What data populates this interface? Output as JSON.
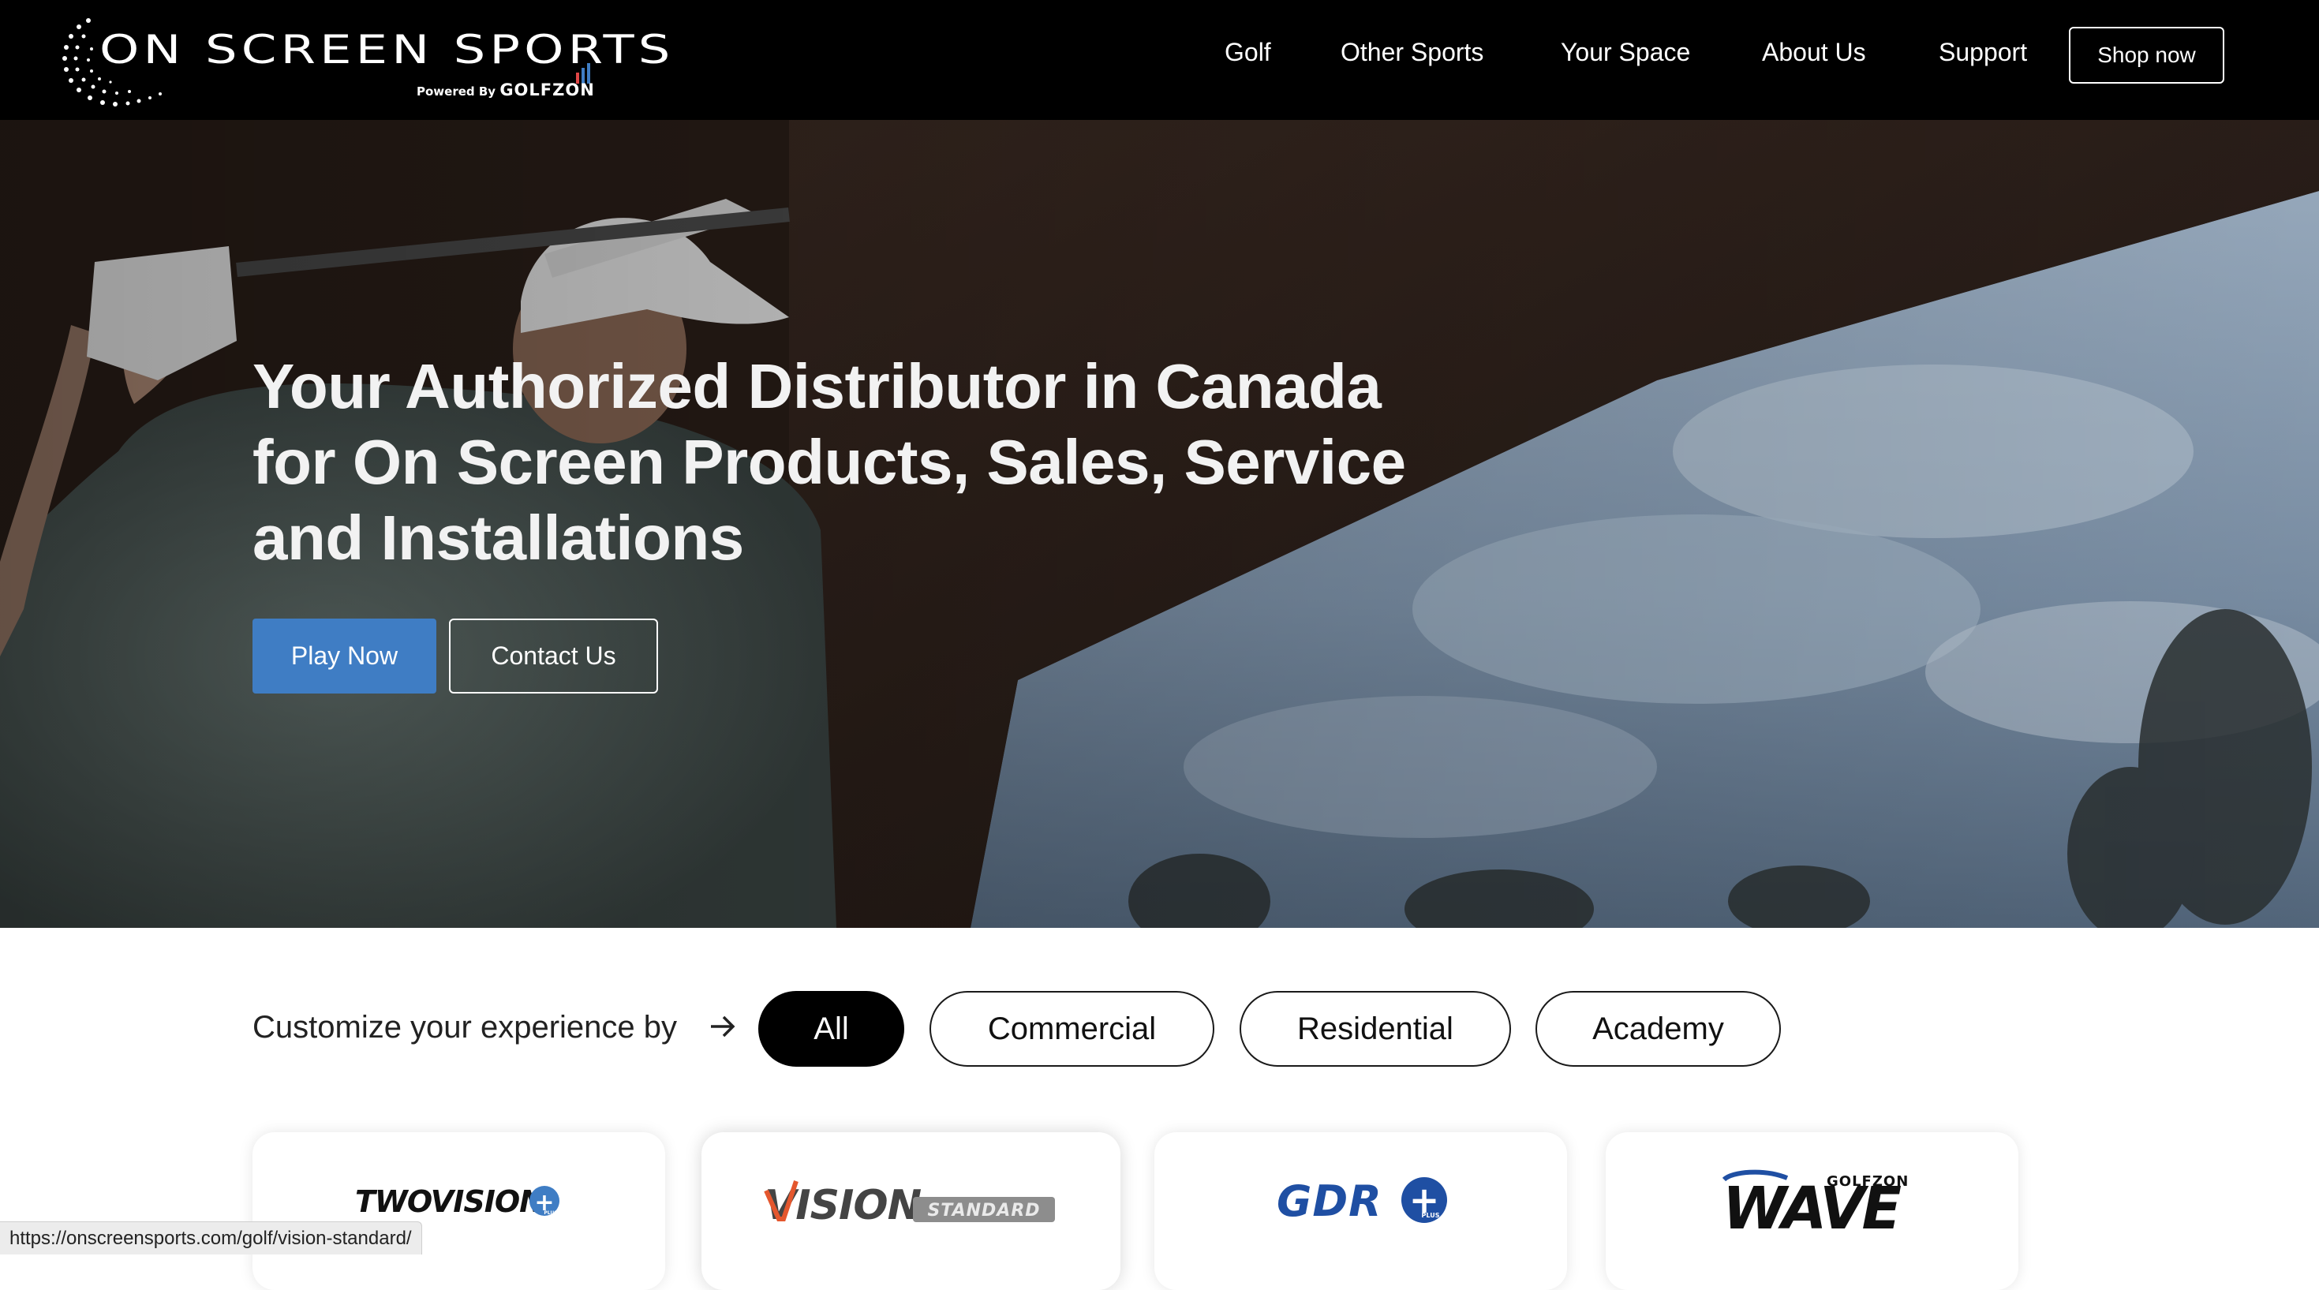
{
  "brand": {
    "title": "ON SCREEN SPORTS",
    "powered_by": "Powered By",
    "partner": "GOLFZON"
  },
  "nav": {
    "links": [
      "Golf",
      "Other Sports",
      "Your Space",
      "About Us",
      "Support"
    ],
    "cta": "Shop now"
  },
  "hero": {
    "title": "Your Authorized Distributor in Canada for On Screen Products, Sales, Service and Installations",
    "primary_button": "Play Now",
    "secondary_button": "Contact Us"
  },
  "filter": {
    "label": "Customize your experience by",
    "arrow_icon": "arrow-right-icon",
    "options": [
      "All",
      "Commercial",
      "Residential",
      "Academy"
    ],
    "selected": "All"
  },
  "products": [
    {
      "name": "TWOVISION",
      "badge": "+",
      "badge_sub": "PLUS"
    },
    {
      "name": "VISION",
      "badge": "STANDARD"
    },
    {
      "name": "GDR",
      "badge": "+",
      "badge_sub": "PLUS"
    },
    {
      "name": "WAVE",
      "brand": "GOLFZON"
    }
  ],
  "colors": {
    "nav_bg": "#000000",
    "primary": "#3f7dc4",
    "gdr_blue": "#1f4fa3",
    "vision_orange": "#e4572e"
  },
  "status_bar": {
    "url": "https://onscreensports.com/golf/vision-standard/"
  }
}
